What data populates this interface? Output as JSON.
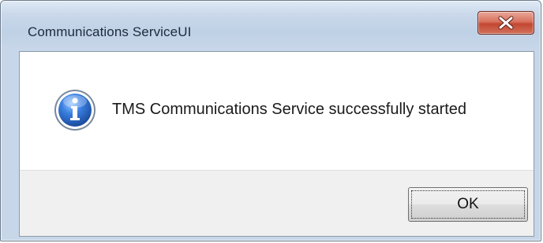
{
  "window": {
    "title": "Communications ServiceUI",
    "close_icon": "close-x-icon"
  },
  "dialog": {
    "icon": "information-icon",
    "message": "TMS Communications Service successfully started",
    "ok_label": "OK"
  },
  "colors": {
    "close_button": "#c24732",
    "info_icon": "#2f6cc4"
  }
}
